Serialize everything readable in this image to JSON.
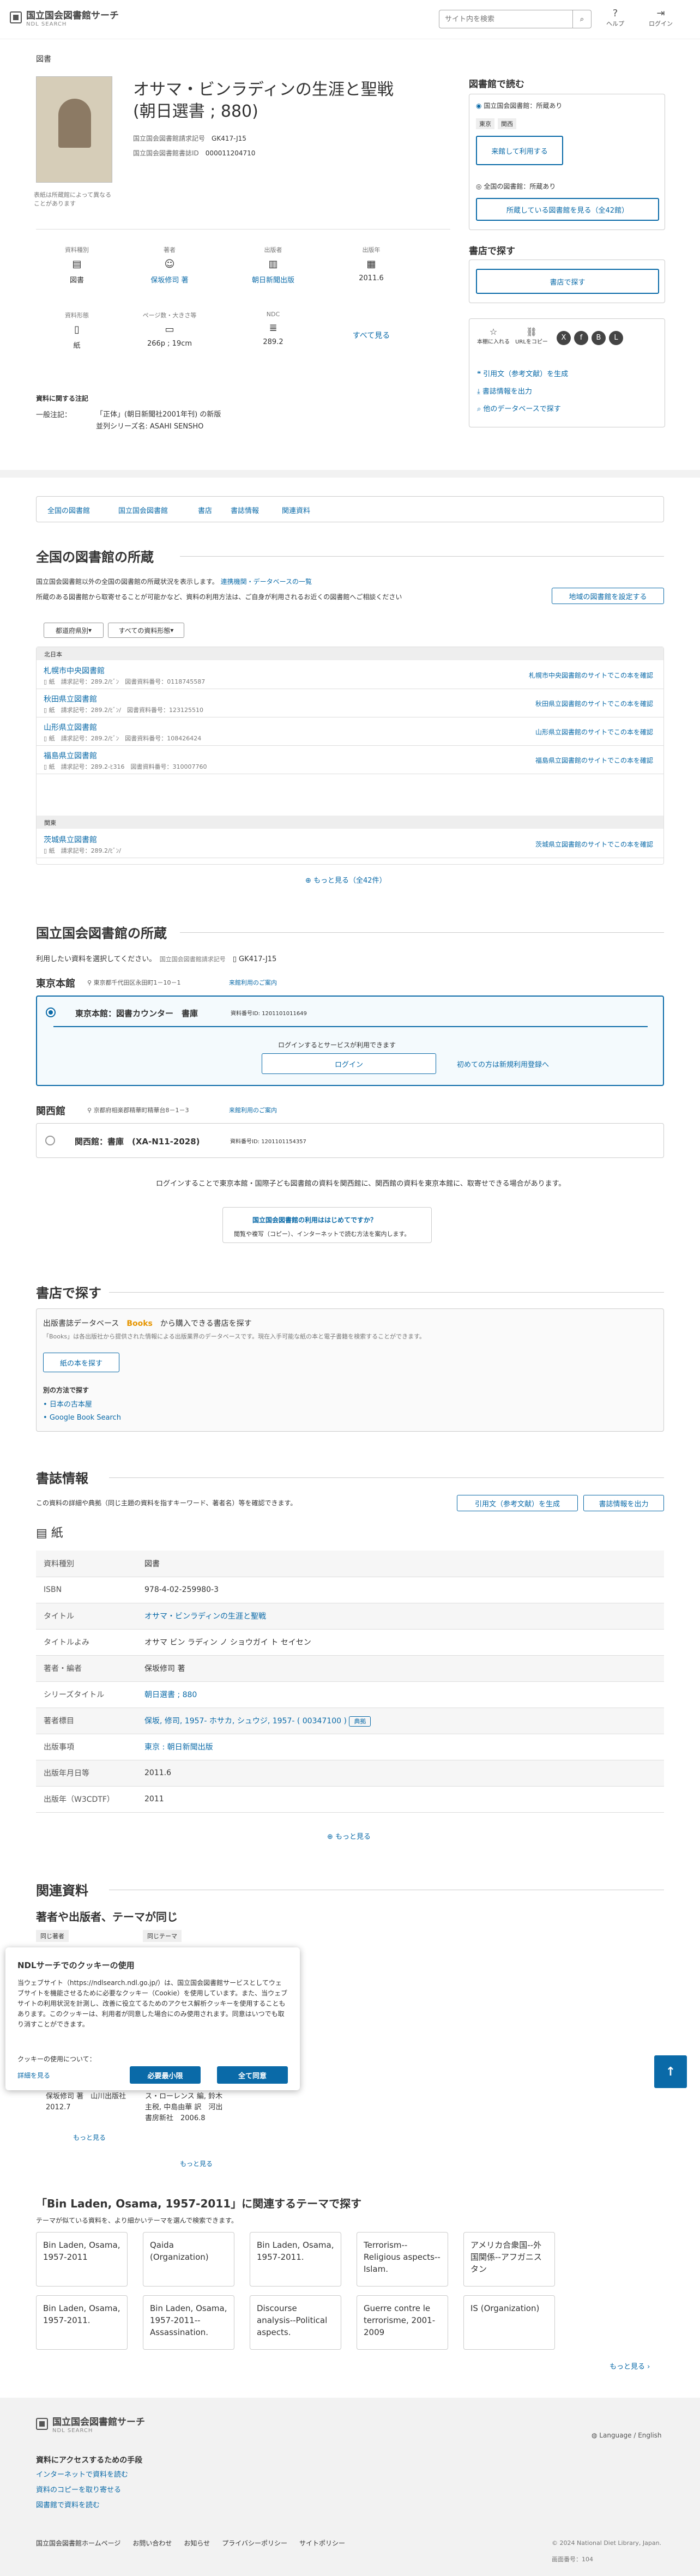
{
  "header": {
    "logo_jp": "国立国会図書館サーチ",
    "logo_en": "NDL SEARCH",
    "search_placeholder": "サイト内を検索",
    "help": "ヘルプ",
    "login": "ログイン"
  },
  "breadcrumb": "図書",
  "book": {
    "title": "オサマ・ビンラディンの生涯と聖戦",
    "title_sub": "(朝日選書 ; 880)",
    "ndc_call_label": "国立国会図書館請求記号",
    "ndc_call": "GK417-J15",
    "bib_id_label": "国立国会図書館書誌ID",
    "bib_id": "000011204710",
    "cover_note": "表紙は所蔵館によって異なることがあります"
  },
  "facets": [
    {
      "k": "資料種別",
      "v": "図書"
    },
    {
      "k": "著者",
      "v": "保坂修司 著"
    },
    {
      "k": "出版者",
      "v": "朝日新聞出版"
    },
    {
      "k": "出版年",
      "v": "2011.6"
    },
    {
      "k": "資料形態",
      "v": "紙"
    },
    {
      "k": "ページ数・大きさ等",
      "v": "266p ; 19cm"
    },
    {
      "k": "NDC",
      "v": "289.2"
    }
  ],
  "see_all": "すべて見る",
  "notes": {
    "head": "資料に関する注記",
    "label": "一般注記：",
    "l1": "「正体」(朝日新聞社2001年刊) の新版",
    "l2": "並列シリーズ名: ASAHI SENSHO"
  },
  "side": {
    "read_head": "図書館で読む",
    "ndl_hold": "国立国会図書館：所蔵あり",
    "tokyo": "東京",
    "kansai": "関西",
    "use_btn": "来館して利用する",
    "national": "全国の図書館：所蔵あり",
    "libs_btn": "所蔵している図書館を見る（全42館）",
    "shop_head": "書店で探す",
    "shop_btn": "書店で探す",
    "share": [
      "本棚に入れる",
      "URLをコピー"
    ],
    "cite": "引用文（参考文献）を生成",
    "export": "書誌情報を出力",
    "other_db": "他のデータベースで探す"
  },
  "tabs": [
    "全国の図書館",
    "国立国会図書館",
    "書店",
    "書誌情報",
    "関連資料"
  ],
  "national": {
    "head": "全国の図書館の所蔵",
    "desc": "国立国会図書館以外の全国の図書館の所蔵状況を表示します。",
    "link": "連携機関・データベースの一覧",
    "desc2": "所蔵のある図書館から取寄せることが可能かなど、資料の利用方法は、ご自身が利用されるお近くの図書館へご相談ください",
    "set_btn": "地域の図書館を設定する",
    "filter1": "都道府県別",
    "filter2": "すべての資料形態",
    "groups": [
      {
        "region": "北日本",
        "rows": [
          {
            "name": "札幌市中央図書館",
            "call": "289.2/ﾋﾞﾝ",
            "id": "0118745587",
            "link": "札幌市中央図書館のサイトでこの本を確認"
          },
          {
            "name": "秋田県立図書館",
            "call": "289.2/ﾋﾞﾝ/",
            "id": "123125510",
            "link": "秋田県立図書館のサイトでこの本を確認"
          },
          {
            "name": "山形県立図書館",
            "call": "289.2/ﾋﾞﾝ",
            "id": "108426424",
            "link": "山形県立図書館のサイトでこの本を確認"
          },
          {
            "name": "福島県立図書館",
            "call": "289.2-ﾋ316",
            "id": "310007760",
            "link": "福島県立図書館のサイトでこの本を確認"
          }
        ]
      },
      {
        "region": "関東",
        "rows": [
          {
            "name": "茨城県立図書館",
            "call": "289.2/ﾋﾞﾝ/",
            "id": "",
            "link": "茨城県立図書館のサイトでこの本を確認"
          }
        ]
      }
    ],
    "type": "紙",
    "call_label": "請求記号：",
    "id_label": "図書資料番号：",
    "more": "もっと見る（全42件）"
  },
  "ndl": {
    "head": "国立国会図書館の所蔵",
    "desc": "利用したい資料を選択してください。",
    "call_label": "国立国会図書館請求記号",
    "call": "GK417-J15",
    "tokyo": "東京本館",
    "tokyo_addr": "東京都千代田区永田町1－10－1",
    "guide": "来館利用のご案内",
    "tokyo_item": "東京本館：図書カウンター　書庫",
    "tokyo_id": "資料番号ID: 1201101011649",
    "login_msg": "ログインするとサービスが利用できます",
    "login_btn": "ログイン",
    "register": "初めての方は新規利用登録へ",
    "kansai": "関西館",
    "kansai_addr": "京都府相楽郡精華町精華台8－1－3",
    "kansai_item": "関西館：書庫　(XA-N11-2028)",
    "kansai_id": "資料番号ID: 1201101154357",
    "bottom_note": "ログインすることで東京本館・国際子ども図書館の資料を関西館に、関西館の資料を東京本館に、取寄せできる場合があります。",
    "banner_title": "国立国会図書館の利用ははじめてですか？",
    "banner_sub": "閲覧や複写（コピー）、インターネットで読む方法を案内します。"
  },
  "shop": {
    "head": "書店で探す",
    "db": "出版書誌データベース",
    "brand": "Books",
    "db_tail": "から購入できる書店を探す",
    "note": "「Books」は各出版社から提供された情報による出版業界のデータベースです。現在入手可能な紙の本と電子書籍を検索することができます。",
    "paper_btn": "紙の本を探す",
    "other": "別の方法で探す",
    "l1": "日本の古本屋",
    "l2": "Google Book Search"
  },
  "bib": {
    "head": "書誌情報",
    "desc": "この資料の詳細や典拠（同じ主題の資料を指すキーワード、著者名）等を確認できます。",
    "cite": "引用文（参考文献）を生成",
    "export": "書誌情報を出力",
    "form": "紙",
    "rows": [
      {
        "k": "資料種別",
        "v": "図書"
      },
      {
        "k": "ISBN",
        "v": "978-4-02-259980-3"
      },
      {
        "k": "タイトル",
        "v": "オサマ・ビンラディンの生涯と聖戦"
      },
      {
        "k": "タイトルよみ",
        "v": "オサマ ビン ラディン ノ ショウガイ ト セイセン"
      },
      {
        "k": "著者・編者",
        "v": "保坂修司 著"
      },
      {
        "k": "シリーズタイトル",
        "v": "朝日選書 ; 880"
      },
      {
        "k": "著者標目",
        "v": "保坂, 修司, 1957- ホサカ, シュウジ, 1957- ( 00347100 )"
      },
      {
        "k": "出版事項",
        "v": "東京 : 朝日新聞出版"
      },
      {
        "k": "出版年月日等",
        "v": "2011.6"
      },
      {
        "k": "出版年（W3CDTF）",
        "v": "2011"
      }
    ],
    "authority": "典拠",
    "more": "もっと見る"
  },
  "related": {
    "head": "関連資料",
    "sub": "著者や出版者、テーマが同じ",
    "tab1": "同じ著者",
    "tab2": "同じテーマ",
    "r1": {
      "title": "保坂修司 著　山川出版社　2012.7"
    },
    "r2": {
      "title": "ス・ローレンス 編, 鈴木主税, 中島由華 訳　河出書房新社　2006.8"
    },
    "more1": "もっと見る",
    "more2": "もっと見る",
    "themes_head": "「Bin Laden, Osama, 1957-2011」に関連するテーマで探す",
    "themes_desc": "テーマが似ている資料を、より細かいテーマを選んで検索できます。",
    "themes_more": "もっと見る",
    "themes": [
      "Bin Laden, Osama, 1957-2011",
      "Qaida (Organization)",
      "Bin Laden, Osama, 1957-2011.",
      "Terrorism--Religious aspects--Islam.",
      "アメリカ合衆国--外国関係--アフガニスタン",
      "Bin Laden, Osama, 1957-2011.",
      "Bin Laden, Osama, 1957-2011--Assassination.",
      "Discourse analysis--Political aspects.",
      "Guerre contre le terrorisme, 2001-2009",
      "IS (Organization)"
    ]
  },
  "cookie": {
    "title": "NDLサーチでのクッキーの使用",
    "body": "当ウェブサイト（https://ndlsearch.ndl.go.jp/）は、国立国会図書館サービスとしてウェブサイトを機能させるために必要なクッキー（Cookie）を使用しています。また、当ウェブサイトの利用状況を計測し、改善に役立てるためのアクセス解析クッキーを使用することもあります。このクッキーは、利用者が同意した場合にのみ使用されます。同意はいつでも取り消すことができます。",
    "q": "クッキーの使用について：",
    "details": "詳細を見る",
    "essential": "必要最小限",
    "all": "全て同意"
  },
  "footer": {
    "logo_jp": "国立国会図書館サーチ",
    "logo_en": "NDL SEARCH",
    "lang": "Language / English",
    "access_head": "資料にアクセスするための手段",
    "l1": "インターネットで資料を読む",
    "l2": "資料のコピーを取り寄せる",
    "l3": "図書館で資料を読む",
    "links": [
      "国立国会図書館ホームページ",
      "お問い合わせ",
      "お知らせ",
      "プライバシーポリシー",
      "サイトポリシー"
    ],
    "copy": "© 2024 National Diet Library, Japan.",
    "screen": "画面番号：104"
  }
}
